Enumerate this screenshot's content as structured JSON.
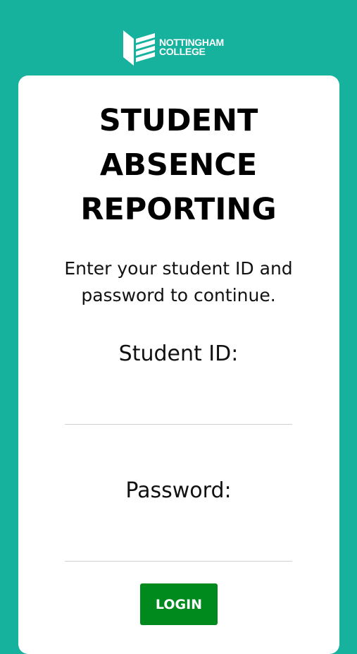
{
  "brand": {
    "logo_line1": "NOTTINGHAM",
    "logo_line2": "COLLEGE"
  },
  "page": {
    "title_line1": "STUDENT",
    "title_line2": "ABSENCE",
    "title_line3": "REPORTING",
    "instruction_line1": "Enter your student ID and",
    "instruction_line2": "password to continue."
  },
  "form": {
    "student_id_label": "Student ID:",
    "student_id_value": "",
    "password_label": "Password:",
    "password_value": "",
    "login_label": "LOGIN"
  },
  "colors": {
    "background": "#17b29e",
    "card": "#ffffff",
    "login_button": "#008a1e"
  },
  "icons": {
    "logo": "nottingham-college-logo-icon"
  }
}
